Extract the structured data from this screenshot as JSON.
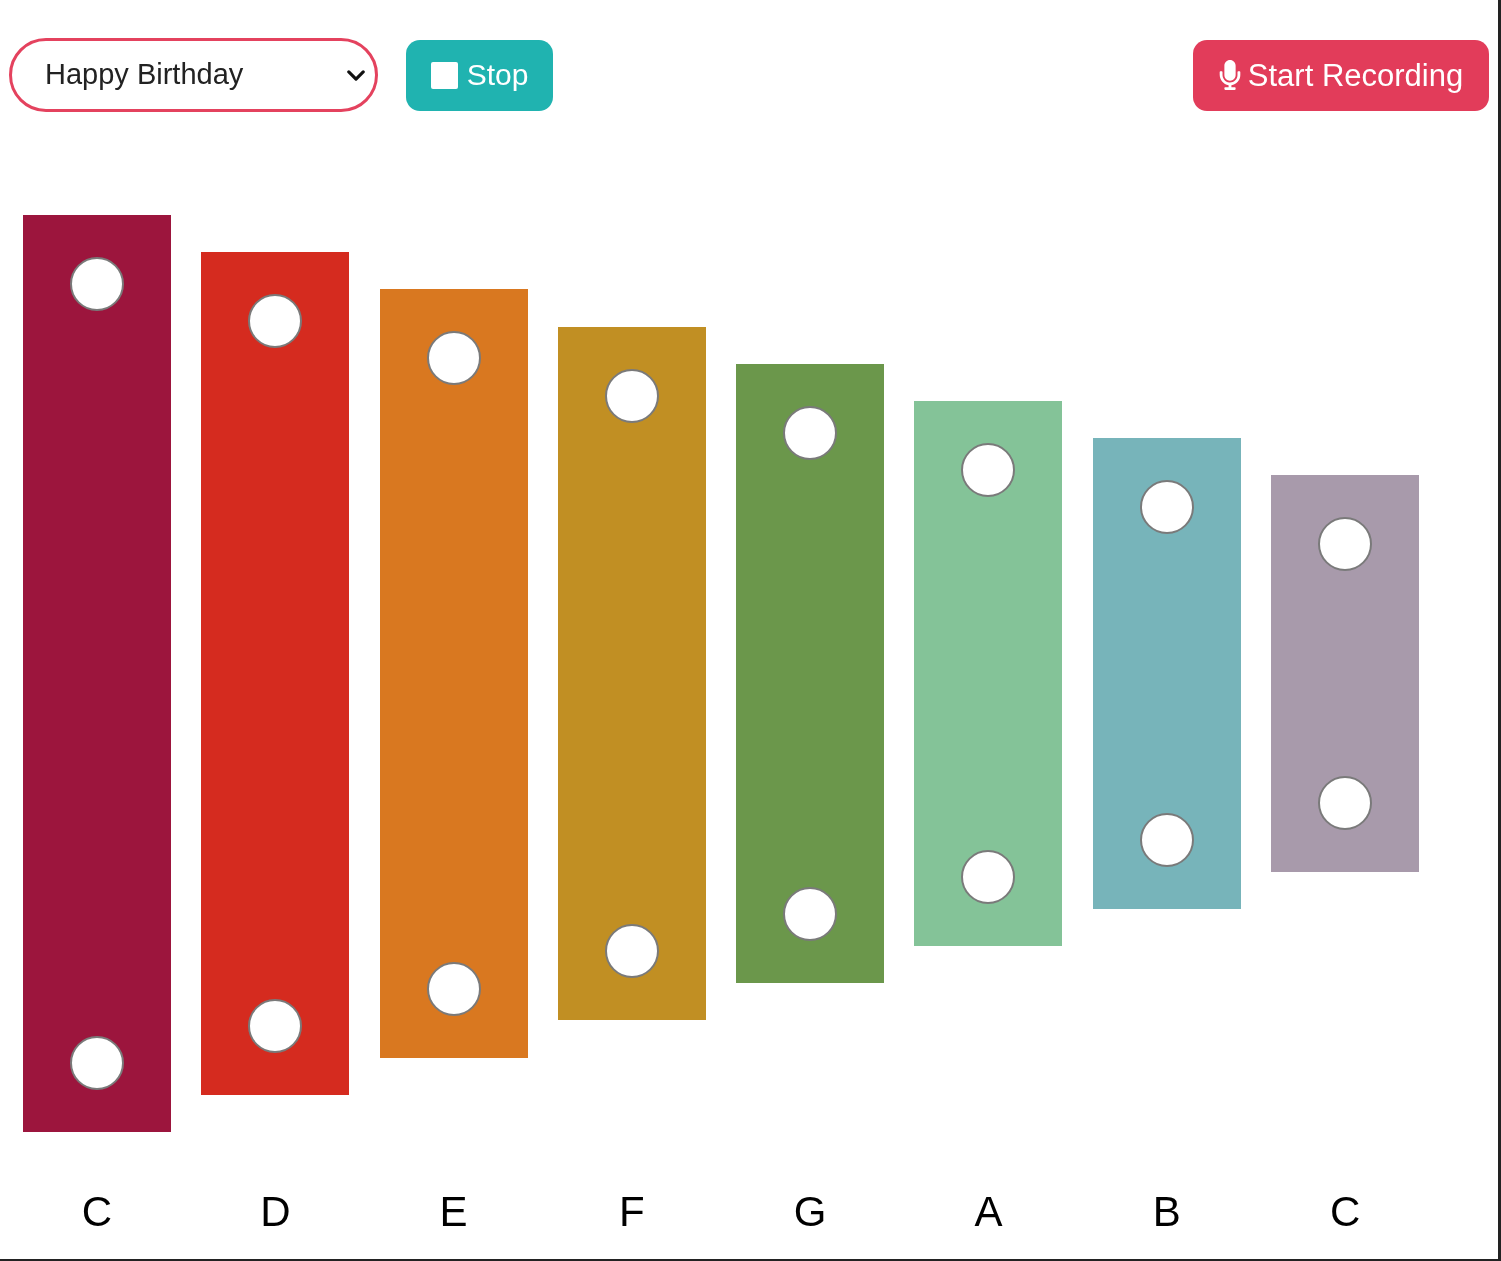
{
  "song_select": {
    "value": "Happy Birthday"
  },
  "buttons": [
    {
      "kind": "stop",
      "label": "Stop"
    },
    {
      "kind": "record",
      "label": "Start Recording"
    }
  ],
  "bars": [
    {
      "note": "C",
      "color": "#9c153d"
    },
    {
      "note": "D",
      "color": "#d52b1f"
    },
    {
      "note": "E",
      "color": "#d97820"
    },
    {
      "note": "F",
      "color": "#c18f23"
    },
    {
      "note": "G",
      "color": "#6b974b"
    },
    {
      "note": "A",
      "color": "#84c398"
    },
    {
      "note": "B",
      "color": "#77b4ba"
    },
    {
      "note": "C",
      "color": "#a89aab"
    }
  ]
}
